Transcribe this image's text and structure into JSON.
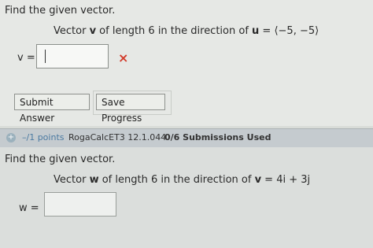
{
  "question1": {
    "prompt": "Find the given vector.",
    "text_before": "Vector ",
    "vector_name": "v",
    "text_middle": " of length 6 in the direction of ",
    "direction_name": "u",
    "equals_value": " = ⟨−5, −5⟩",
    "answer_label": "v =",
    "answer_value": "",
    "error_icon": "×"
  },
  "buttons": {
    "submit_label": "Submit Answer",
    "save_label": "Save Progress"
  },
  "question2_header": {
    "icon": "+",
    "points": "–/1 points",
    "source": "RogaCalcET3 12.1.044.",
    "submissions": "0/6 Submissions Used"
  },
  "question2": {
    "prompt": "Find the given vector.",
    "text_before": "Vector ",
    "vector_name": "w",
    "text_middle": " of length 6 in the direction of ",
    "direction_name": "v",
    "equals_value": " = 4i + 3j",
    "answer_label": "w =",
    "answer_value": ""
  },
  "colors": {
    "error": "#d23b2b",
    "points_link": "#4b7aa2",
    "header_bar": "#c5cbcf"
  }
}
